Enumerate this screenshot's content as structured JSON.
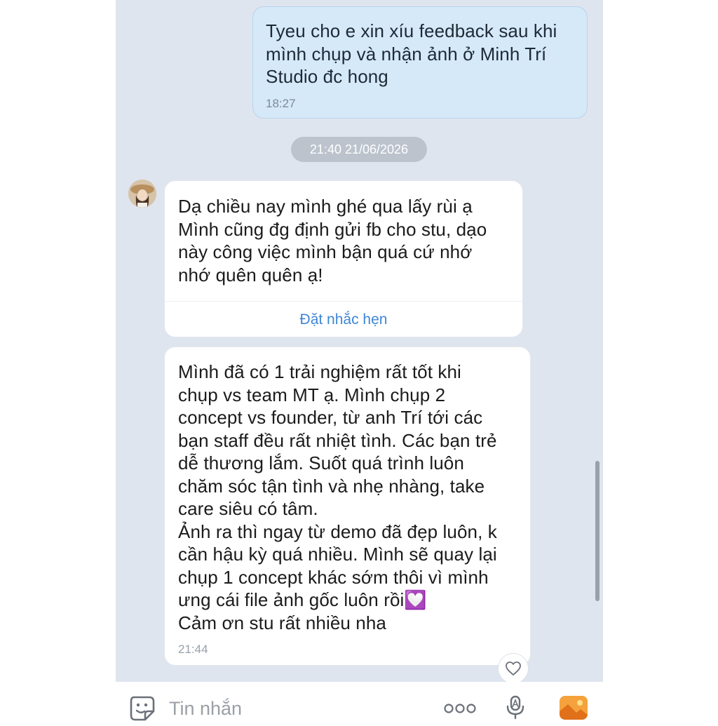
{
  "conversation": {
    "outgoing": {
      "text": "Tyeu cho e xin xíu feedback sau khi\nmình chụp và nhận ảnh ở Minh Trí\nStudio đc hong",
      "time": "18:27"
    },
    "date_separator": "21:40 21/06/2026",
    "incoming": [
      {
        "text": "Dạ chiều nay mình ghé qua lấy rùi ạ\nMình cũng đg định gửi fb cho stu, dạo\nnày công việc mình bận quá cứ nhớ\nnhớ quên quên ạ!",
        "action": "Đặt nhắc hẹn"
      },
      {
        "text": "Mình đã có 1 trải nghiệm rất tốt khi\nchụp vs team MT ạ. Mình chụp 2\nconcept vs founder, từ anh Trí tới các\nbạn staff đều rất nhiệt tình. Các bạn trẻ\ndễ thương lắm. Suốt quá trình luôn\nchăm sóc tận tình và nhẹ nhàng, take\ncare siêu có tâm.\nẢnh ra thì ngay từ demo đã đẹp luôn, k\ncần hậu kỳ quá nhiều. Mình sẽ quay lại\nchụp 1 concept khác sớm thôi vì mình\nưng cái file ảnh gốc luôn rồi💟\nCảm ơn stu rất nhiều nha",
        "time": "21:44"
      }
    ]
  },
  "input_bar": {
    "placeholder": "Tin nhắn"
  },
  "icons": {
    "avatar": "avatar",
    "reaction": "heart-icon",
    "sticker": "sticker-icon",
    "more": "more-dots-icon",
    "voice": "microphone-icon",
    "image": "image-icon"
  },
  "colors": {
    "chat_background": "#dfe5ef",
    "outgoing_bubble": "#d5e9f9",
    "incoming_bubble": "#ffffff",
    "link_accent": "#3f86d6",
    "image_button": "#f39c33"
  }
}
